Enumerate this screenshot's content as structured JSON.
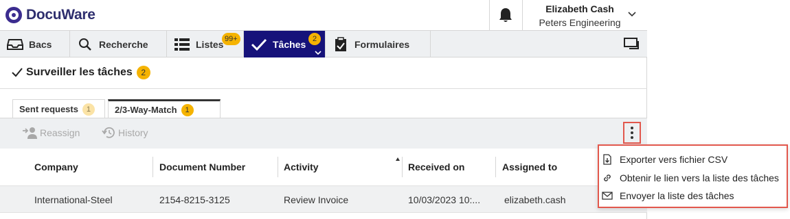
{
  "app": {
    "logo_text": "DocuWare",
    "user_name": "Elizabeth Cash",
    "user_company": "Peters Engineering"
  },
  "nav": {
    "items": [
      {
        "label": "Bacs",
        "icon": "tray-icon"
      },
      {
        "label": "Recherche",
        "icon": "search-icon"
      },
      {
        "label": "Listes",
        "icon": "list-icon",
        "badge": "99+"
      },
      {
        "label": "Tâches",
        "icon": "check-icon",
        "badge": "2",
        "active": true
      },
      {
        "label": "Formulaires",
        "icon": "clipboard-icon"
      }
    ]
  },
  "page": {
    "title": "Surveiller les tâches",
    "title_badge": "2"
  },
  "tabs": [
    {
      "label": "Sent requests",
      "badge": "1",
      "active": false
    },
    {
      "label": "2/3-Way-Match",
      "badge": "1",
      "active": true
    }
  ],
  "toolbar": {
    "reassign_label": "Reassign",
    "history_label": "History"
  },
  "table": {
    "columns": [
      "Company",
      "Document Number",
      "Activity",
      "Received on",
      "Assigned to"
    ],
    "rows": [
      [
        "International-Steel",
        "2154-8215-3125",
        "Review Invoice",
        "10/03/2023 10:...",
        "elizabeth.cash"
      ]
    ]
  },
  "menu": {
    "items": [
      {
        "label": "Exporter vers fichier CSV",
        "icon": "export-file-icon"
      },
      {
        "label": "Obtenir le lien vers la liste des tâches",
        "icon": "link-icon"
      },
      {
        "label": "Envoyer la liste des tâches",
        "icon": "mail-icon"
      }
    ]
  },
  "colors": {
    "accent": "#16127a",
    "badge": "#f5b301",
    "highlight": "#e2574c"
  }
}
